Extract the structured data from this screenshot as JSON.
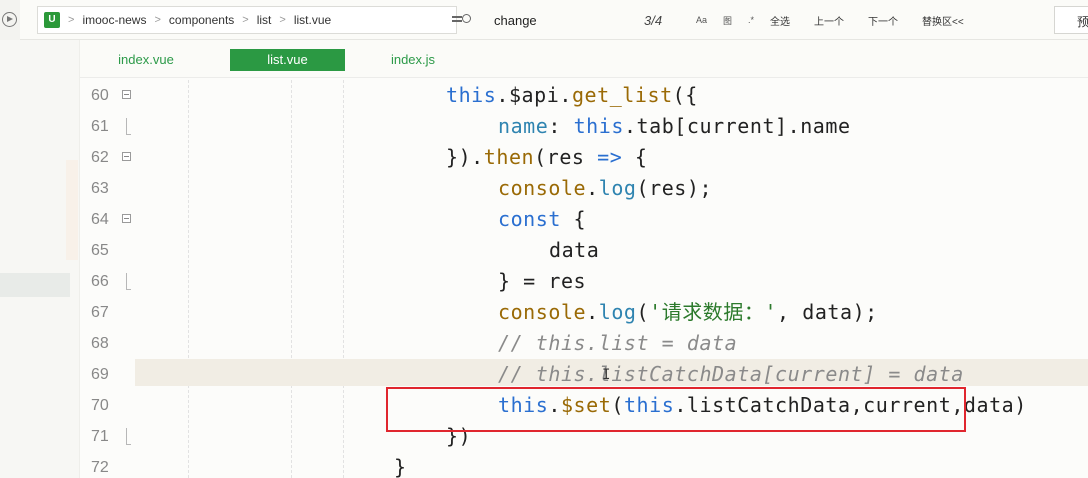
{
  "breadcrumb": {
    "logo": "U",
    "items": [
      "imooc-news",
      "components",
      "list",
      "list.vue"
    ]
  },
  "find": {
    "term": "change",
    "count": "3/4",
    "opt_case": "Aa",
    "opt_word": "图",
    "opt_regex": ".*",
    "select_all": "全选",
    "prev": "上一个",
    "next": "下一个",
    "replace": "替换区<<"
  },
  "preview": "预",
  "tabs": [
    {
      "label": "index.vue",
      "active": false
    },
    {
      "label": "list.vue",
      "active": true
    },
    {
      "label": "index.js",
      "active": false
    }
  ],
  "lines": [
    {
      "n": "60",
      "fold": "box",
      "indent": 2,
      "tokens": [
        [
          "kw",
          "this"
        ],
        [
          "",
          "."
        ],
        [
          "",
          "$api"
        ],
        [
          "",
          "."
        ],
        [
          "fn",
          "get_list"
        ],
        [
          "",
          "({"
        ]
      ]
    },
    {
      "n": "61",
      "fold": "line",
      "indent": 3,
      "tokens": [
        [
          "prop",
          "name"
        ],
        [
          "",
          ": "
        ],
        [
          "kw",
          "this"
        ],
        [
          "",
          ".tab[current]"
        ],
        [
          "",
          "."
        ],
        [
          "",
          "name"
        ]
      ]
    },
    {
      "n": "62",
      "fold": "box",
      "indent": 2,
      "tokens": [
        [
          "",
          "})."
        ],
        [
          "fn",
          "then"
        ],
        [
          "",
          "(res "
        ],
        [
          "op",
          "=>"
        ],
        [
          "",
          " {"
        ]
      ]
    },
    {
      "n": "63",
      "fold": "",
      "indent": 3,
      "tokens": [
        [
          "fn",
          "console"
        ],
        [
          "",
          "."
        ],
        [
          "prop",
          "log"
        ],
        [
          "",
          "(res);"
        ]
      ]
    },
    {
      "n": "64",
      "fold": "box",
      "indent": 3,
      "tokens": [
        [
          "kw",
          "const"
        ],
        [
          "",
          " {"
        ]
      ]
    },
    {
      "n": "65",
      "fold": "",
      "indent": 4,
      "tokens": [
        [
          "",
          "data"
        ]
      ]
    },
    {
      "n": "66",
      "fold": "line",
      "indent": 3,
      "tokens": [
        [
          "",
          "} = res"
        ]
      ]
    },
    {
      "n": "67",
      "fold": "",
      "indent": 3,
      "tokens": [
        [
          "fn",
          "console"
        ],
        [
          "",
          "."
        ],
        [
          "prop",
          "log"
        ],
        [
          "",
          "("
        ],
        [
          "str",
          "'请求数据：'"
        ],
        [
          "",
          ", data);"
        ]
      ]
    },
    {
      "n": "68",
      "fold": "",
      "indent": 3,
      "tokens": [
        [
          "cmt",
          "// this.list = data"
        ]
      ]
    },
    {
      "n": "69",
      "fold": "",
      "indent": 3,
      "tokens": [
        [
          "cmt",
          "// this.listCatchData[current] = data"
        ]
      ]
    },
    {
      "n": "70",
      "fold": "",
      "indent": 3,
      "tokens": [
        [
          "kw",
          "this"
        ],
        [
          "",
          "."
        ],
        [
          "fn",
          "$set"
        ],
        [
          "",
          "("
        ],
        [
          "kw",
          "this"
        ],
        [
          "",
          ".listCatchData,current,data)"
        ]
      ]
    },
    {
      "n": "71",
      "fold": "line",
      "indent": 2,
      "tokens": [
        [
          "",
          "})"
        ]
      ]
    },
    {
      "n": "72",
      "fold": "",
      "indent": 1,
      "tokens": [
        [
          "",
          "}"
        ]
      ]
    }
  ]
}
